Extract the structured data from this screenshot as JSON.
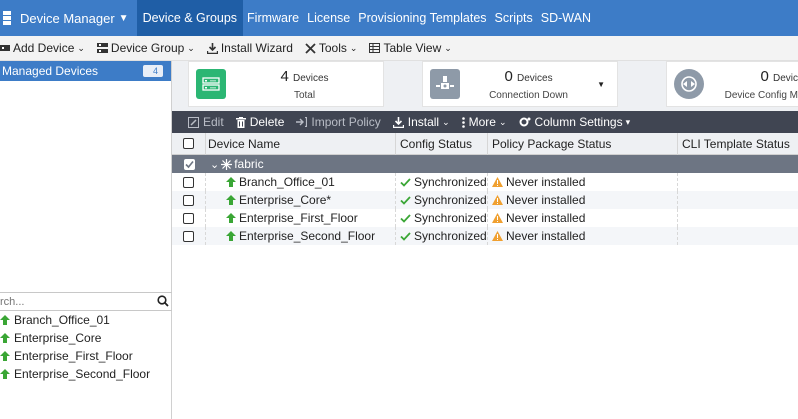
{
  "topnav": {
    "app_menu": "Device Manager",
    "tabs": [
      {
        "label": "Device & Groups",
        "active": true
      },
      {
        "label": "Firmware"
      },
      {
        "label": "License"
      },
      {
        "label": "Provisioning Templates"
      },
      {
        "label": "Scripts"
      },
      {
        "label": "SD-WAN"
      }
    ]
  },
  "toolbar": {
    "add_device": "Add Device",
    "device_group": "Device Group",
    "install_wizard": "Install Wizard",
    "tools": "Tools",
    "table_view": "Table View"
  },
  "leftpanel": {
    "managed_label": "Managed Devices",
    "managed_count": "4",
    "search_placeholder": "rch...",
    "devices": [
      "Branch_Office_01",
      "Enterprise_Core",
      "Enterprise_First_Floor",
      "Enterprise_Second_Floor"
    ]
  },
  "cards": [
    {
      "count": "4",
      "unit": "Devices",
      "label": "Total",
      "color": "#2bb673"
    },
    {
      "count": "0",
      "unit": "Devices",
      "label": "Connection Down",
      "color": "#8e9aa8"
    },
    {
      "count": "0",
      "unit": "Devic",
      "label": "Device Config M",
      "color": "#8e9aa8"
    }
  ],
  "actionbar": {
    "edit": "Edit",
    "delete": "Delete",
    "import_policy": "Import Policy",
    "install": "Install",
    "more": "More",
    "column_settings": "Column Settings"
  },
  "table": {
    "headers": {
      "name": "Device Name",
      "config": "Config Status",
      "policy": "Policy Package Status",
      "cli": "CLI Template Status"
    },
    "group": "fabric",
    "rows": [
      {
        "name": "Branch_Office_01",
        "config": "Synchronized",
        "policy": "Never installed"
      },
      {
        "name": "Enterprise_Core*",
        "config": "Synchronized",
        "policy": "Never installed"
      },
      {
        "name": "Enterprise_First_Floor",
        "config": "Synchronized",
        "policy": "Never installed"
      },
      {
        "name": "Enterprise_Second_Floor",
        "config": "Synchronized",
        "policy": "Never installed"
      }
    ]
  },
  "colors": {
    "nav": "#3d7cc7",
    "nav_active": "#1f5ea6",
    "actionbar": "#404552",
    "group_row": "#6d7583",
    "ok": "#3aa635",
    "warn": "#f0a030"
  }
}
